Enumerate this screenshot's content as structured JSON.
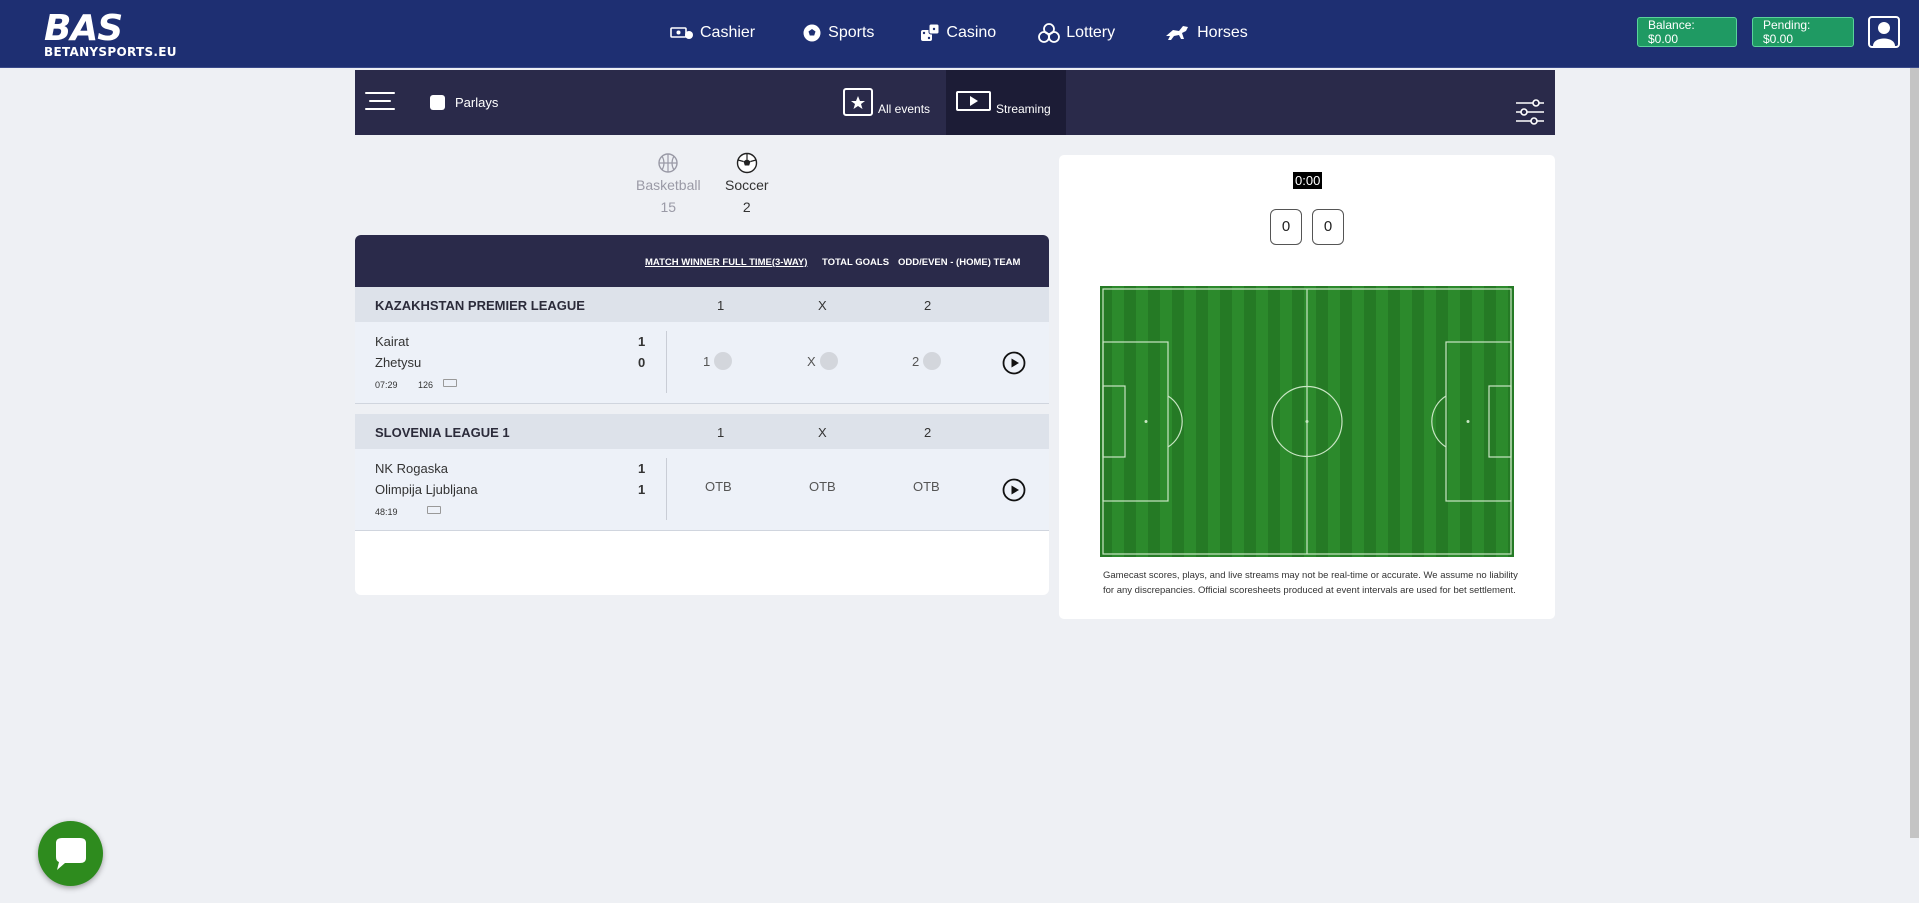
{
  "logo": {
    "big": "BAS",
    "small": "BETANYSPORTS.EU"
  },
  "nav": [
    {
      "label": "Cashier",
      "icon": "cashier-icon"
    },
    {
      "label": "Sports",
      "icon": "soccer-ball-icon"
    },
    {
      "label": "Casino",
      "icon": "dice-icon"
    },
    {
      "label": "Lottery",
      "icon": "lottery-balls-icon"
    },
    {
      "label": "Horses",
      "icon": "horse-icon"
    }
  ],
  "account": {
    "balance": "Balance: $0.00",
    "pending": "Pending: $0.00"
  },
  "toolbar": {
    "parlays": "Parlays",
    "all_events": "All events",
    "streaming": "Streaming"
  },
  "sports": [
    {
      "name": "Basketball",
      "count": "15"
    },
    {
      "name": "Soccer",
      "count": "2"
    }
  ],
  "markets": {
    "match_winner": "MATCH WINNER FULL TIME(3-WAY)",
    "total_goals": "TOTAL GOALS",
    "odd_even": "ODD/EVEN - (HOME) TEAM"
  },
  "leagues": [
    {
      "name": "KAZAKHSTAN PREMIER LEAGUE",
      "cols": [
        "1",
        "X",
        "2"
      ],
      "game": {
        "home": "Kairat",
        "away": "Zhetysu",
        "home_score": "1",
        "away_score": "0",
        "clock": "07:29",
        "extra": "126",
        "odds": [
          "1",
          "X",
          "2"
        ]
      }
    },
    {
      "name": "SLOVENIA LEAGUE 1",
      "cols": [
        "1",
        "X",
        "2"
      ],
      "game": {
        "home": "NK Rogaska",
        "away": "Olimpija Ljubljana",
        "home_score": "1",
        "away_score": "1",
        "clock": "48:19",
        "odds": [
          "OTB",
          "OTB",
          "OTB"
        ]
      }
    }
  ],
  "gamecast": {
    "time": "0:00",
    "score_home": "0",
    "score_away": "0",
    "disclaimer": "Gamecast scores, plays, and live streams may not be real-time or accurate. We assume no liability for any discrepancies. Official scoresheets produced at event intervals are used for bet settlement."
  },
  "colors": {
    "nav_bg": "#1e2f72",
    "toolbar_bg": "#2a2a4a",
    "balance_green": "#1f9a63",
    "pitch_green": "#2c8a2c",
    "chat_green": "#2e8b1e"
  }
}
